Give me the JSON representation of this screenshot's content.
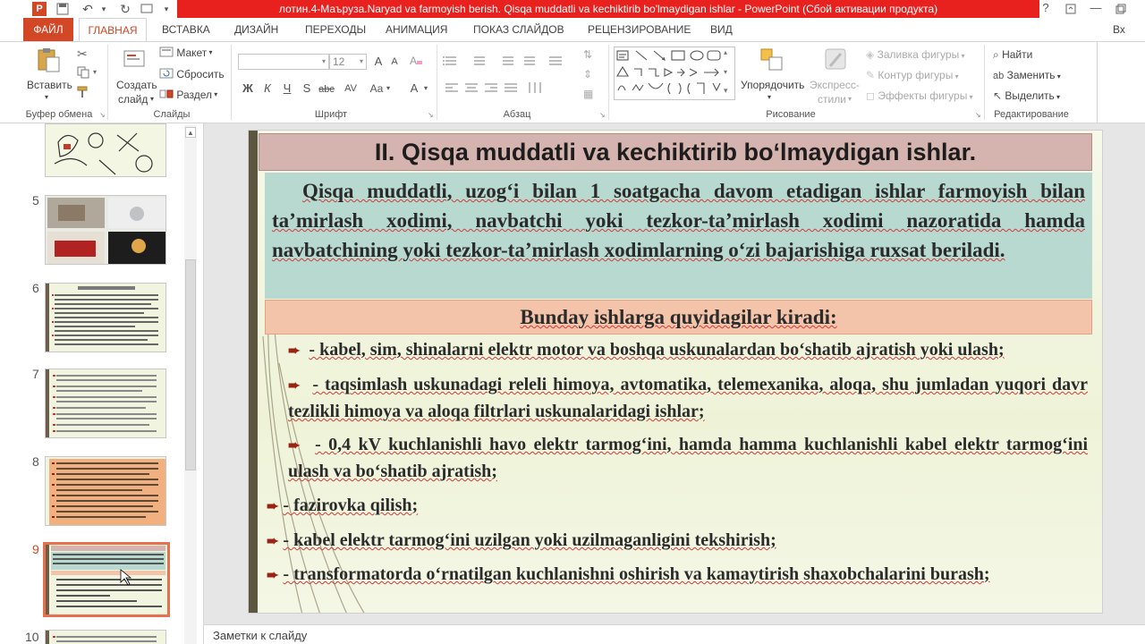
{
  "window": {
    "title": "лотин.4-Маърузa.Naryad va farmoyish berish. Qisqa muddatli va kechiktirib bo'lmaydigan ishlar - PowerPoint (Сбой активации продукта)",
    "help": "?",
    "user_fragment": "Вх"
  },
  "tabs": [
    {
      "label": "ФАЙЛ"
    },
    {
      "label": "ГЛАВНАЯ"
    },
    {
      "label": "ВСТАВКА"
    },
    {
      "label": "ДИЗАЙН"
    },
    {
      "label": "ПЕРЕХОДЫ"
    },
    {
      "label": "АНИМАЦИЯ"
    },
    {
      "label": "ПОКАЗ СЛАЙДОВ"
    },
    {
      "label": "РЕЦЕНЗИРОВАНИЕ"
    },
    {
      "label": "ВИД"
    }
  ],
  "ribbon": {
    "clipboard": {
      "paste": "Вставить",
      "group": "Буфер обмена"
    },
    "slides": {
      "new_slide_1": "Создать",
      "new_slide_2": "слайд",
      "layout": "Макет",
      "reset": "Сбросить",
      "section": "Раздел",
      "group": "Слайды"
    },
    "font": {
      "size": "12",
      "group": "Шрифт",
      "bold": "Ж",
      "italic": "К",
      "underline": "Ч",
      "strike": "S",
      "spacing": "AV",
      "case": "Aa",
      "color": "A",
      "grow": "A",
      "shrink": "A"
    },
    "paragraph": {
      "group": "Абзац"
    },
    "drawing": {
      "arrange": "Упорядочить",
      "quick_styles_1": "Экспресс-",
      "quick_styles_2": "стили",
      "fill": "Заливка фигуры",
      "outline": "Контур фигуры",
      "effects": "Эффекты фигуры",
      "group": "Рисование"
    },
    "editing": {
      "find": "Найти",
      "replace": "Заменить",
      "select": "Выделить",
      "group": "Редактирование"
    }
  },
  "thumbnails": [
    {
      "num": "5"
    },
    {
      "num": "6"
    },
    {
      "num": "7"
    },
    {
      "num": "8"
    },
    {
      "num": "9"
    },
    {
      "num": "10"
    }
  ],
  "slide": {
    "title": "II. Qisqa muddatli va kechiktirib bo‘lmaydigan ishlar.",
    "intro": "Qisqa muddatli, uzog‘i bilan 1 soatgacha davom etadigan ishlar farmoyish bilan ta’mirlash xodimi, navbatchi yoki tezkor-ta’mirlash xodimi nazoratida hamda navbatchining yoki tezkor-ta’mirlash xodimlarning o‘zi bajarishiga ruxsat beriladi.",
    "subheading": "Bunday ishlarga quyidagilar kiradi:",
    "bullets": [
      "- kabel, sim, shinalarni elektr motor va boshqa uskunalardan bo‘shatib ajratish yoki ulash;",
      "- taqsimlash uskunadagi releli himoya, avtomatika, telemexanika, aloqa, shu jumladan yuqori davr tezlikli himoya va aloqa filtrlari uskunalaridagi ishlar;",
      "- 0,4 kV kuchlanishli havo elektr tarmog‘ini, hamda hamma kuchlanishli kabel elektr tarmog‘ini ulash va bo‘shatib ajratish;",
      "- fazirovka qilish;",
      "- kabel elektr tarmog‘ini uzilgan yoki uzilmaganligini tekshirish;",
      "- transformatorda o‘rnatilgan kuchlanishni oshirish va kamaytirish shaxobchalarini burash;"
    ]
  },
  "notes": {
    "placeholder": "Заметки к слайду"
  },
  "colors": {
    "accent": "#d24726",
    "title_bar": "#e8201e",
    "slide_title_bg": "#d5b3ae",
    "intro_bg": "#b7d9cf",
    "subheading_bg": "#f3c4a9",
    "bullet_arrow": "#9a2413"
  }
}
